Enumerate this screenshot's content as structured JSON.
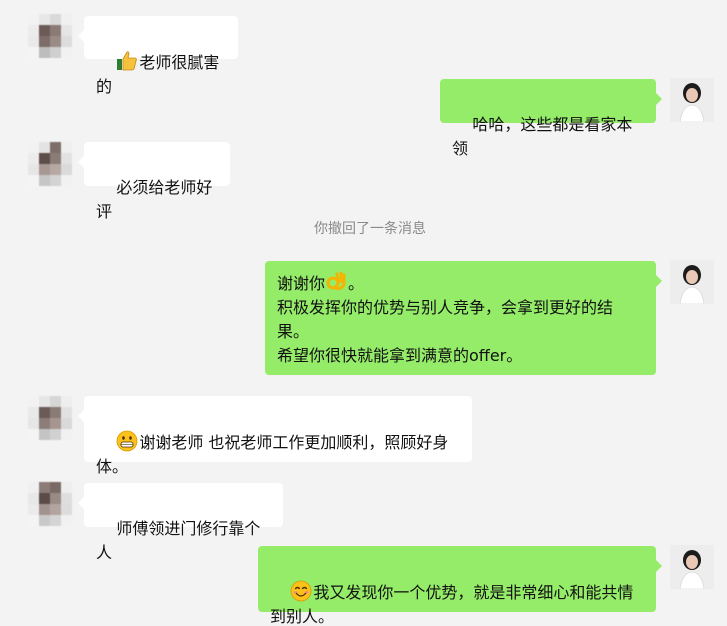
{
  "system_notice": "你撤回了一条消息",
  "messages": [
    {
      "side": "in",
      "icon": "thumbs-up-icon",
      "text": "老师很腻害的"
    },
    {
      "side": "out",
      "text": "哈哈，这些都是看家本领"
    },
    {
      "side": "in",
      "text": "必须给老师好评"
    },
    {
      "side": "out",
      "text_before_icon": "谢谢你",
      "icon": "ok-hand-icon",
      "text_after_icon": "。\n积极发挥你的优势与别人竞争，会拿到更好的结果。\n希望你很快就能拿到满意的offer。"
    },
    {
      "side": "in",
      "icon": "grinning-face-icon",
      "text": "谢谢老师 也祝老师工作更加顺利，照顾好身体。"
    },
    {
      "side": "in",
      "text": "师傅领进门修行靠个人"
    },
    {
      "side": "out",
      "icon": "smiling-face-icon",
      "text": "我又发现你一个优势，就是非常细心和能共情到别人。"
    }
  ],
  "colors": {
    "background": "#f3f3f3",
    "incoming_bubble": "#ffffff",
    "outgoing_bubble": "#95ec69",
    "system_text": "#8a8a8a"
  }
}
